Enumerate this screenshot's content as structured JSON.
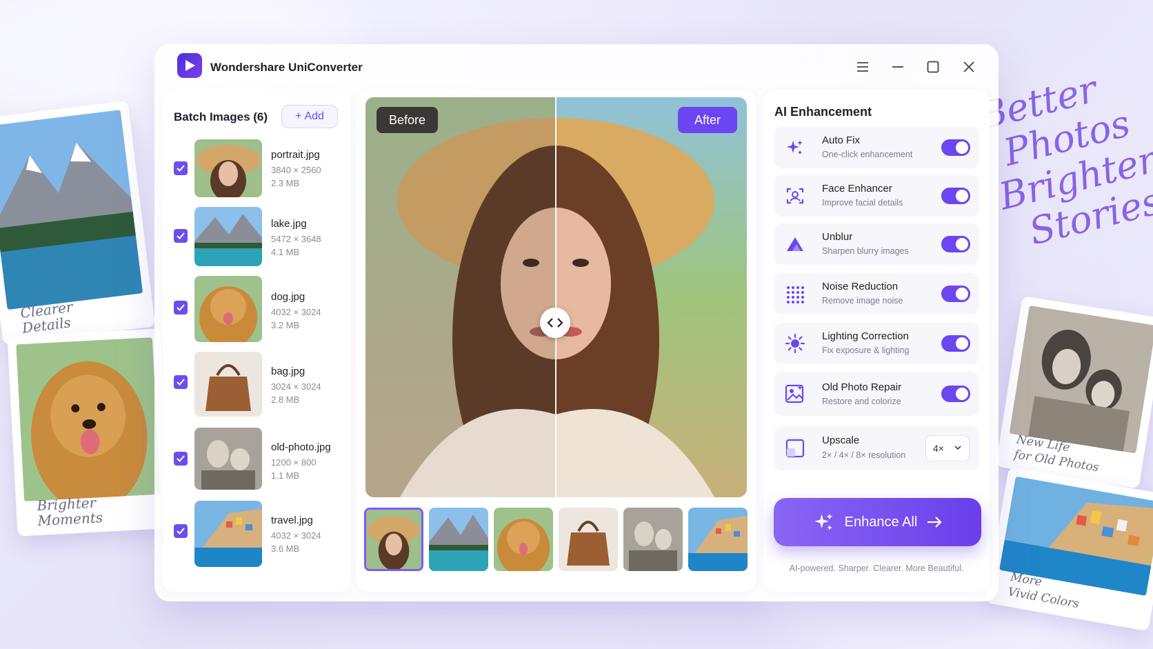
{
  "window": {
    "app_title": "Wondershare UniConverter",
    "controls": [
      "menu-icon",
      "minimize-icon",
      "maximize-icon",
      "close-icon"
    ]
  },
  "batch": {
    "title": "Batch Images (6)",
    "add_label": "Add",
    "files": [
      {
        "name": "portrait.jpg",
        "dims": "3840 × 2560",
        "size": "2.3 MB",
        "checked": true
      },
      {
        "name": "lake.jpg",
        "dims": "5472 × 3648",
        "size": "4.1 MB",
        "checked": true
      },
      {
        "name": "dog.jpg",
        "dims": "4032 × 3024",
        "size": "3.2 MB",
        "checked": true
      },
      {
        "name": "bag.jpg",
        "dims": "3024 × 3024",
        "size": "2.8 MB",
        "checked": true
      },
      {
        "name": "old-photo.jpg",
        "dims": "1200 × 800",
        "size": "1.1 MB",
        "checked": true
      },
      {
        "name": "travel.jpg",
        "dims": "4032 × 3024",
        "size": "3.6 MB",
        "checked": true
      }
    ]
  },
  "preview": {
    "before_label": "Before",
    "after_label": "After",
    "thumbnails": [
      "portrait",
      "lake",
      "dog",
      "bag",
      "old-photo",
      "travel"
    ],
    "active_thumbnail": 0
  },
  "enhancement": {
    "title": "AI Enhancement",
    "features": [
      {
        "label": "Auto Fix",
        "desc": "One-click enhancement",
        "icon": "sparkles-icon",
        "enabled": true
      },
      {
        "label": "Face Enhancer",
        "desc": "Improve facial details",
        "icon": "face-scan-icon",
        "enabled": true
      },
      {
        "label": "Unblur",
        "desc": "Sharpen blurry images",
        "icon": "triangle-icon",
        "enabled": true
      },
      {
        "label": "Noise Reduction",
        "desc": "Remove image noise",
        "icon": "dots-grid-icon",
        "enabled": true
      },
      {
        "label": "Lighting Correction",
        "desc": "Fix exposure & lighting",
        "icon": "sun-icon",
        "enabled": true
      },
      {
        "label": "Old Photo Repair",
        "desc": "Restore and colorize",
        "icon": "image-repair-icon",
        "enabled": true
      }
    ],
    "upscale": {
      "label": "Upscale",
      "desc": "2× / 4× / 8× resolution",
      "selected": "4×",
      "icon": "upscale-icon"
    },
    "enhance_label": "Enhance All",
    "tagline": "AI-powered. Sharper. Clearer. More Beautiful."
  },
  "decor": {
    "handwriting": [
      "Better",
      "Photos",
      "Brighter",
      "Stories"
    ],
    "captions": {
      "mountain": "Clearer\nDetails",
      "dog": "Brighter\nMoments",
      "old_photo": "New Life\nfor Old Photos",
      "coast": "More\nVivid Colors"
    }
  },
  "colors": {
    "accent": "#6c46f0",
    "accent_light": "#8a66f5",
    "background": "#eae8fb"
  }
}
